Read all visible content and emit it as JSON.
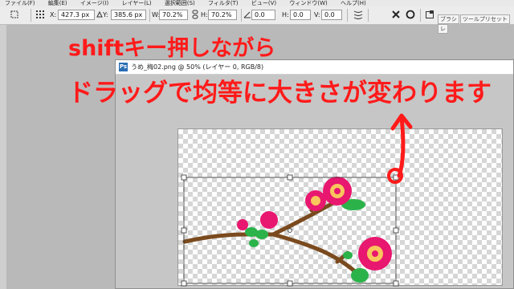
{
  "menubar": {
    "items": [
      "ファイル(F)",
      "編集(E)",
      "イメージ(I)",
      "レイヤー(L)",
      "選択範囲(S)",
      "フィルタ(T)",
      "ビュー(V)",
      "ウィンドウ(W)",
      "ヘルプ(H)"
    ]
  },
  "options_bar": {
    "x_label": "X:",
    "x_value": "427.3 px",
    "y_label": "Y:",
    "y_value": "385.6 px",
    "w_label": "W:",
    "w_value": "70.2%",
    "h_label": "H:",
    "h_value": "70.2%",
    "angle_value": "0.0",
    "hskew_label": "H:",
    "hskew_value": "0.0",
    "vskew_label": "V:",
    "vskew_value": "0.0",
    "panel_tabs": [
      "ブラシ",
      "ツールプリセット",
      "レ"
    ]
  },
  "document": {
    "title": "うめ_梅02.png @ 50% (レイヤー 0, RGB/8)"
  },
  "annotations": {
    "line1": "shiftキー押しながら",
    "line2": "ドラッグで均等に大きさが変わります"
  },
  "colors": {
    "annotation": "#ff1a1a",
    "blossom": "#e8176f",
    "leaf": "#2bb34a",
    "branch": "#7a4a1e"
  }
}
